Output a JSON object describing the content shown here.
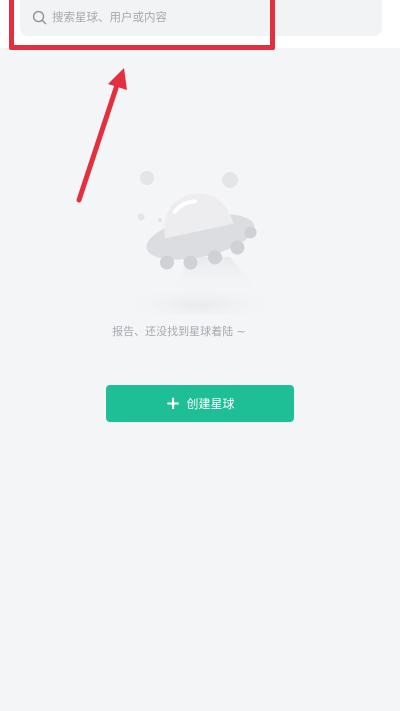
{
  "search": {
    "placeholder": "搜索星球、用户或内容",
    "icon": "search-icon"
  },
  "empty_state": {
    "illustration": "ufo-illustration",
    "message": "报告、还没找到星球着陆 ~"
  },
  "create_button": {
    "label": "创建星球",
    "icon": "plus-icon"
  },
  "annotation": {
    "highlight_color": "#e3303f",
    "arrow": "red-arrow-pointing-to-search"
  },
  "colors": {
    "accent": "#1ebf97",
    "background": "#f4f5f7"
  }
}
